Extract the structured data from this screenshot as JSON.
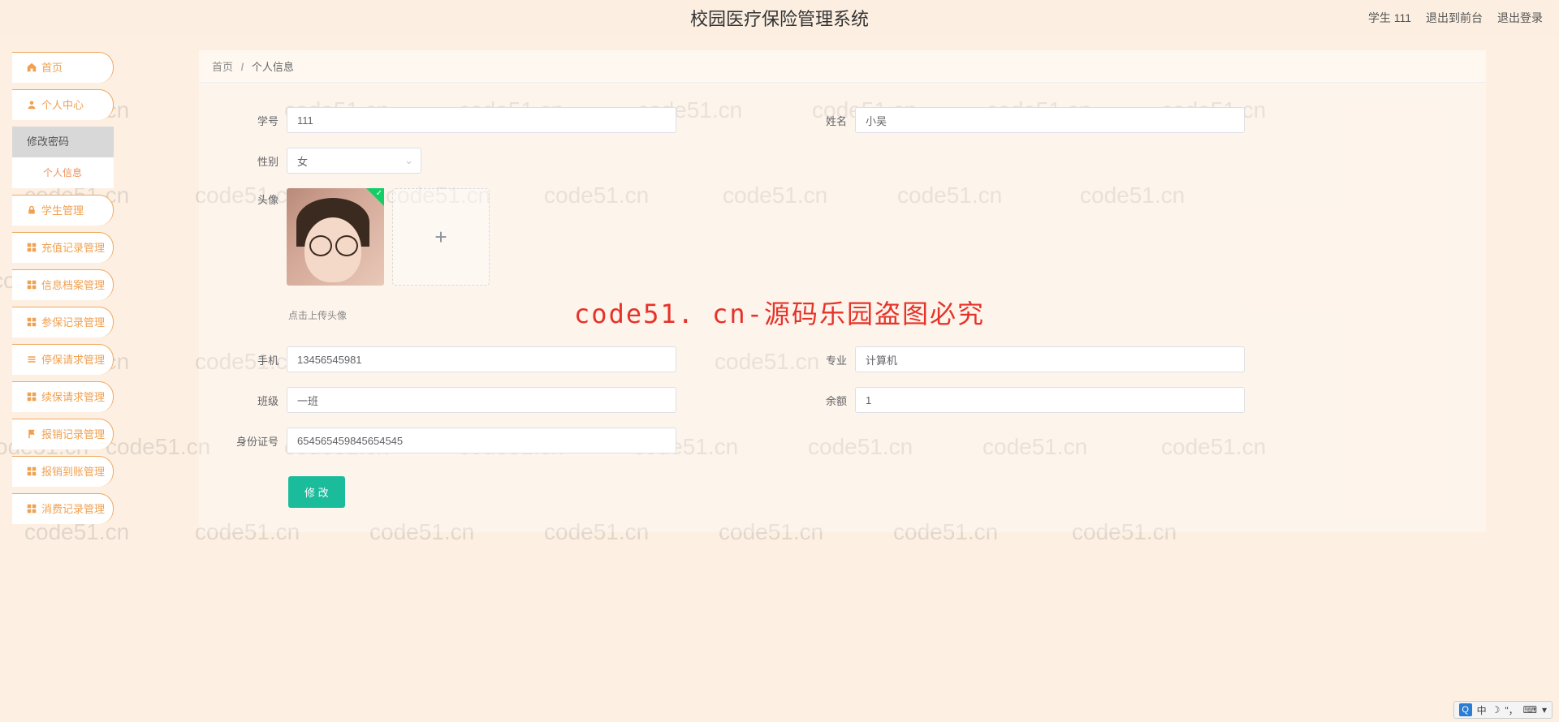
{
  "header": {
    "title": "校园医疗保险管理系统",
    "user_role": "学生",
    "user_id": "111",
    "link_front": "退出到前台",
    "link_logout": "退出登录"
  },
  "sidebar": {
    "items": [
      {
        "label": "首页"
      },
      {
        "label": "个人中心"
      },
      {
        "label": "修改密码",
        "sub": true
      },
      {
        "label": "个人信息",
        "active": true
      },
      {
        "label": "学生管理"
      },
      {
        "label": "充值记录管理"
      },
      {
        "label": "信息档案管理"
      },
      {
        "label": "参保记录管理"
      },
      {
        "label": "停保请求管理"
      },
      {
        "label": "续保请求管理"
      },
      {
        "label": "报销记录管理"
      },
      {
        "label": "报销到账管理"
      },
      {
        "label": "消费记录管理"
      }
    ]
  },
  "breadcrumb": {
    "home": "首页",
    "sep": "/",
    "current": "个人信息"
  },
  "form": {
    "student_id": {
      "label": "学号",
      "value": "111"
    },
    "name": {
      "label": "姓名",
      "value": "小吴"
    },
    "gender": {
      "label": "性别",
      "value": "女"
    },
    "avatar": {
      "label": "头像",
      "tip": "点击上传头像"
    },
    "phone": {
      "label": "手机",
      "value": "13456545981"
    },
    "major": {
      "label": "专业",
      "value": "计算机"
    },
    "class": {
      "label": "班级",
      "value": "一班"
    },
    "balance": {
      "label": "余额",
      "value": "1"
    },
    "id_card": {
      "label": "身份证号",
      "value": "654565459845654545"
    },
    "submit": "修 改"
  },
  "watermark_text": "code51.cn",
  "center_watermark": "code51. cn-源码乐园盗图必究",
  "ime": {
    "char": "中"
  }
}
